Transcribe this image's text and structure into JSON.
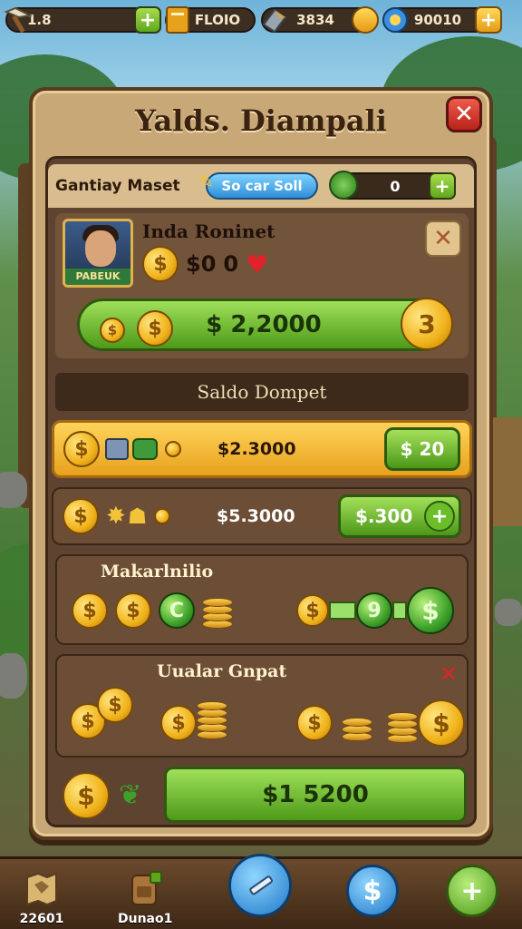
{
  "topbar": {
    "resources": [
      {
        "icon": "pickaxe-icon",
        "value": "1.8",
        "plus_style": "green"
      },
      {
        "icon": "book-icon",
        "value": "FLOIO",
        "plus_style": "none"
      },
      {
        "icon": "gem-block-icon",
        "value": "3834",
        "plus_style": "yellow"
      },
      {
        "icon": "shield-coin-icon",
        "value": "90010",
        "plus_style": "yellow"
      }
    ],
    "plus_glyph": "+"
  },
  "panel": {
    "title": "Yalds. Diampali",
    "close_glyph": "✕"
  },
  "header_row": {
    "label": "Gantiay Maset",
    "blue_button": "So car Soll",
    "counter_value": "0",
    "plus_glyph": "+"
  },
  "player": {
    "name": "Inda Roninet",
    "badge": "PABEUK",
    "money": "$0",
    "count": "0",
    "heart": "♥",
    "close_glyph": "✕",
    "button_amount": "$ 2,2000",
    "coin_glyph": "$",
    "coin_right_glyph": "3"
  },
  "section_title": "Saldo Dompet",
  "rows": [
    {
      "amount": "$2.3000",
      "button": "$ 20",
      "style": "gold"
    },
    {
      "amount": "$5.3000",
      "button": "$.300",
      "style": "brown",
      "plus": "+"
    }
  ],
  "card1": {
    "title": "Makarlnilio",
    "green_coin_glyph": "C",
    "green_coin_glyph2": "9"
  },
  "card2": {
    "title": "Uualar Gnpat",
    "close_glyph": "✕"
  },
  "bottom": {
    "button_amount": "$1 5200"
  },
  "nav": {
    "items": [
      {
        "label": "22601",
        "icon": "map-icon"
      },
      {
        "label": "Dunao1",
        "icon": "backpack-icon"
      },
      {
        "label": "",
        "icon": "pencil-icon"
      },
      {
        "label": "",
        "icon": "dollar-icon"
      },
      {
        "label": "",
        "icon": "plus-icon"
      }
    ],
    "dollar_glyph": "$",
    "plus_glyph": "+"
  },
  "colors": {
    "accent_green": "#5fa61e",
    "accent_gold": "#e8a11d",
    "panel": "#c8a877",
    "close_red": "#b8231a"
  }
}
